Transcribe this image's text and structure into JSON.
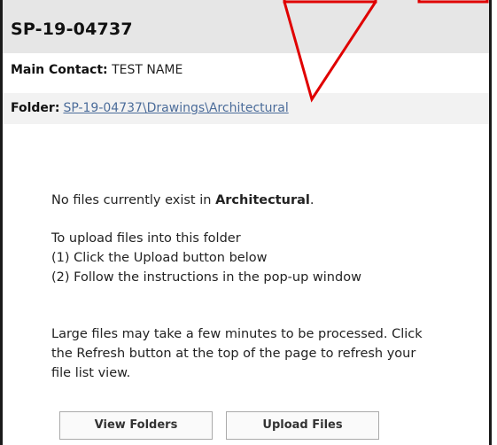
{
  "panel": {
    "title": "SP-19-04737",
    "contact_label": "Main Contact:",
    "contact_value": "TEST NAME",
    "folder_label": "Folder:",
    "folder_path": "SP-19-04737\\Drawings\\Architectural"
  },
  "message": {
    "empty_prefix": "No files currently exist in",
    "folder_name": "Architectural",
    "empty_suffix": ".",
    "upload_intro": "To upload files into this folder",
    "step1": "(1) Click the Upload button below",
    "step2": "(2) Follow the instructions in the pop-up window",
    "large_note_1": "Large files may take a few minutes to be processed. Click",
    "large_note_2": "the Refresh button at the top of the page to refresh your",
    "large_note_3": "file list view."
  },
  "buttons": {
    "view_folders": "View Folders",
    "upload_files": "Upload Files"
  },
  "colors": {
    "annotation": "#e00000",
    "link": "#4b6c9a",
    "header_bg": "#e6e6e6"
  }
}
